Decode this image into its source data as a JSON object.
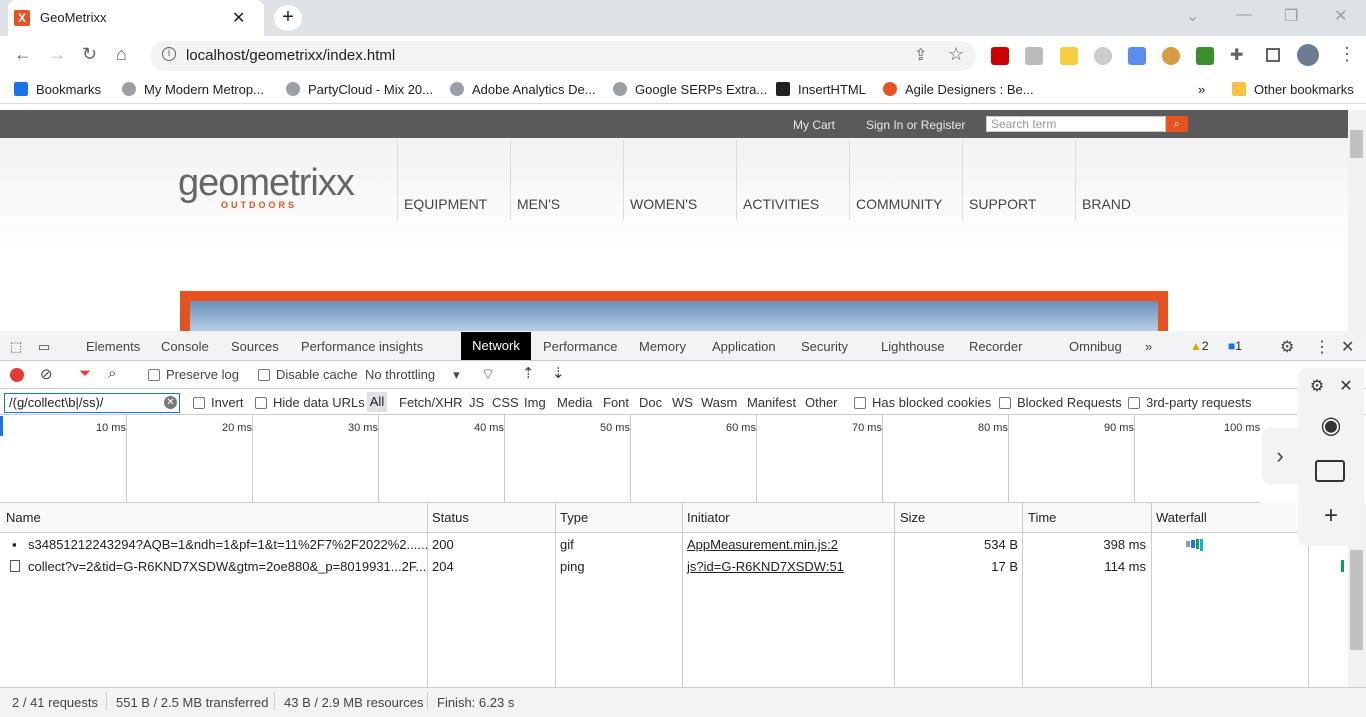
{
  "browser": {
    "tab_title": "GeoMetrixx",
    "tab_favicon": "X",
    "new_tab_label": "+",
    "url": "localhost/geometrixx/index.html",
    "bookmarks_label": "Bookmarks",
    "bookmarks": [
      "My Modern Metrop...",
      "PartyCloud - Mix 20...",
      "Adobe Analytics De...",
      "Google SERPs Extra...",
      "InsertHTML",
      "Agile Designers : Be..."
    ],
    "more_bookmarks": "»",
    "other_bookmarks": "Other bookmarks"
  },
  "site": {
    "my_cart": "My Cart",
    "sign_in": "Sign In or Register",
    "search_placeholder": "Search term",
    "logo_main": "geometrixx",
    "logo_sub": "OUTDOORS",
    "nav": [
      "EQUIPMENT",
      "MEN'S",
      "WOMEN'S",
      "ACTIVITIES",
      "COMMUNITY",
      "SUPPORT",
      "BRAND"
    ]
  },
  "devtools": {
    "tabs": [
      "Elements",
      "Console",
      "Sources",
      "Performance insights",
      "Network",
      "Performance",
      "Memory",
      "Application",
      "Security",
      "Lighthouse",
      "Recorder",
      "Omnibug"
    ],
    "more_tabs": "»",
    "warnings_count": "2",
    "messages_count": "1",
    "preserve_log": "Preserve log",
    "disable_cache": "Disable cache",
    "throttling": "No throttling",
    "filter_value": "/(g/collect\\b|/ss)/",
    "invert": "Invert",
    "hide_data_urls": "Hide data URLs",
    "type_filters": [
      "All",
      "Fetch/XHR",
      "JS",
      "CSS",
      "Img",
      "Media",
      "Font",
      "Doc",
      "WS",
      "Wasm",
      "Manifest",
      "Other"
    ],
    "has_blocked_cookies": "Has blocked cookies",
    "blocked_requests": "Blocked Requests",
    "third_party": "3rd-party requests",
    "timeline_labels": [
      "10 ms",
      "20 ms",
      "30 ms",
      "40 ms",
      "50 ms",
      "60 ms",
      "70 ms",
      "80 ms",
      "90 ms",
      "100 ms"
    ],
    "columns": [
      "Name",
      "Status",
      "Type",
      "Initiator",
      "Size",
      "Time",
      "Waterfall"
    ],
    "rows": [
      {
        "name": "s34851212243294?AQB=1&ndh=1&pf=1&t=11%2F7%2F2022%2......",
        "status": "200",
        "type": "gif",
        "initiator": "AppMeasurement.min.js:2",
        "size": "534 B",
        "time": "398 ms"
      },
      {
        "name": "collect?v=2&tid=G-R6KND7XSDW&gtm=2oe880&_p=8019931...2F...",
        "status": "204",
        "type": "ping",
        "initiator": "js?id=G-R6KND7XSDW:51",
        "size": "17 B",
        "time": "114 ms"
      }
    ],
    "status": {
      "requests": "2 / 41 requests",
      "transferred": "551 B / 2.5 MB transferred",
      "resources": "43 B / 2.9 MB resources",
      "finish": "Finish: 6.23 s"
    }
  },
  "colors": {
    "brand": "#e8521f",
    "devtools_active_tab": "#000000"
  }
}
